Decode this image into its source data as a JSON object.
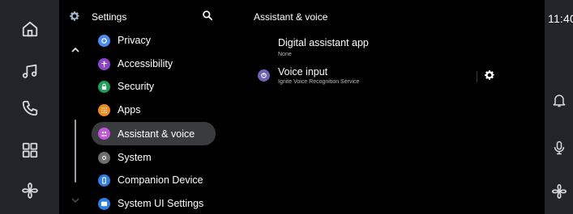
{
  "clock": "11:40",
  "settings_header": {
    "title": "Settings"
  },
  "menu": {
    "items": [
      {
        "label": "Privacy",
        "color": "#4a8af4"
      },
      {
        "label": "Accessibility",
        "color": "#8e44c8"
      },
      {
        "label": "Security",
        "color": "#1e9e58"
      },
      {
        "label": "Apps",
        "color": "#f08a1c"
      },
      {
        "label": "Assistant & voice",
        "color": "#c056d8",
        "selected": true
      },
      {
        "label": "System",
        "color": "#6e6e6e"
      },
      {
        "label": "Companion Device",
        "color": "#2f7de1"
      },
      {
        "label": "System UI Settings",
        "color": "#2f7de1"
      }
    ]
  },
  "detail": {
    "title": "Assistant & voice",
    "digital_assistant": {
      "title": "Digital assistant app",
      "value": "None"
    },
    "voice_input": {
      "title": "Voice input",
      "value": "Ignite Voice Recognition Service"
    }
  },
  "icons": {
    "left_rail": [
      "home-icon",
      "music-icon",
      "phone-icon",
      "apps-grid-icon",
      "fan-icon"
    ],
    "right_rail": [
      "notification-bell-icon",
      "microphone-icon",
      "fan-icon"
    ]
  }
}
